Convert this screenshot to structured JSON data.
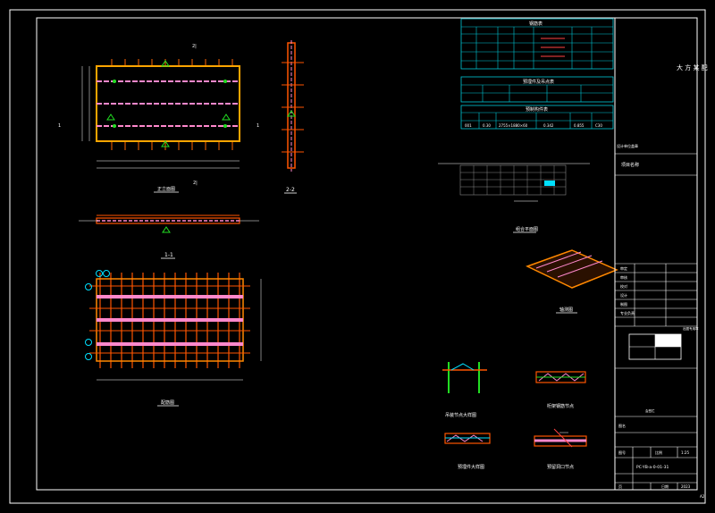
{
  "colors": {
    "background": "#000000",
    "frame": "#ffffff",
    "panel_red": "#ff4444",
    "panel_orange": "#ff8800",
    "rebar_pink": "#ff88cc",
    "marker_green": "#22dd22",
    "tables_cyan": "#00c8d8",
    "accent_cyan": "#00e0ff"
  },
  "panel_top_label": "2|",
  "panel_bottom_label": "2|",
  "panel_left_label": "1",
  "panel_right_label": "1",
  "front_view_caption": "正立面图",
  "section_22_caption": "2-2",
  "section_11_caption": "1-1",
  "rebar_view_caption": "配筋图",
  "plan_caption": "组合平面图",
  "iso_caption": "轴测图",
  "detail_captions": {
    "d1": "吊装节点大样图",
    "d2": "桁架钢筋节点",
    "d3": "预埋件大样图",
    "d4": "预留洞口节点"
  },
  "tables": {
    "rebar_title": "钢筋表",
    "embed_title": "预埋件及吊点表",
    "panel_title": "预制构件表",
    "panel_row": [
      "001",
      "0.30",
      "2755×1880×60",
      "0.342",
      "0.855",
      "C30"
    ]
  },
  "title_block": {
    "company": "大 方 某 配",
    "company_sub": "设计单位盖章",
    "project_label": "项目名称",
    "sign_rows": [
      "审定",
      "审核",
      "校对",
      "设计",
      "制图",
      "专业负责"
    ],
    "stamp_label": "出图专用章",
    "check_label": "会签栏",
    "drawing_title_label": "图名",
    "drawing_no_label": "图号",
    "scale_label": "比例",
    "scale_value": "1:25",
    "drawing_no": "PC-YB-a-0-01-31",
    "date_label": "日期",
    "date_value": "2023",
    "page_label": "页"
  },
  "corner_mark": "A2"
}
